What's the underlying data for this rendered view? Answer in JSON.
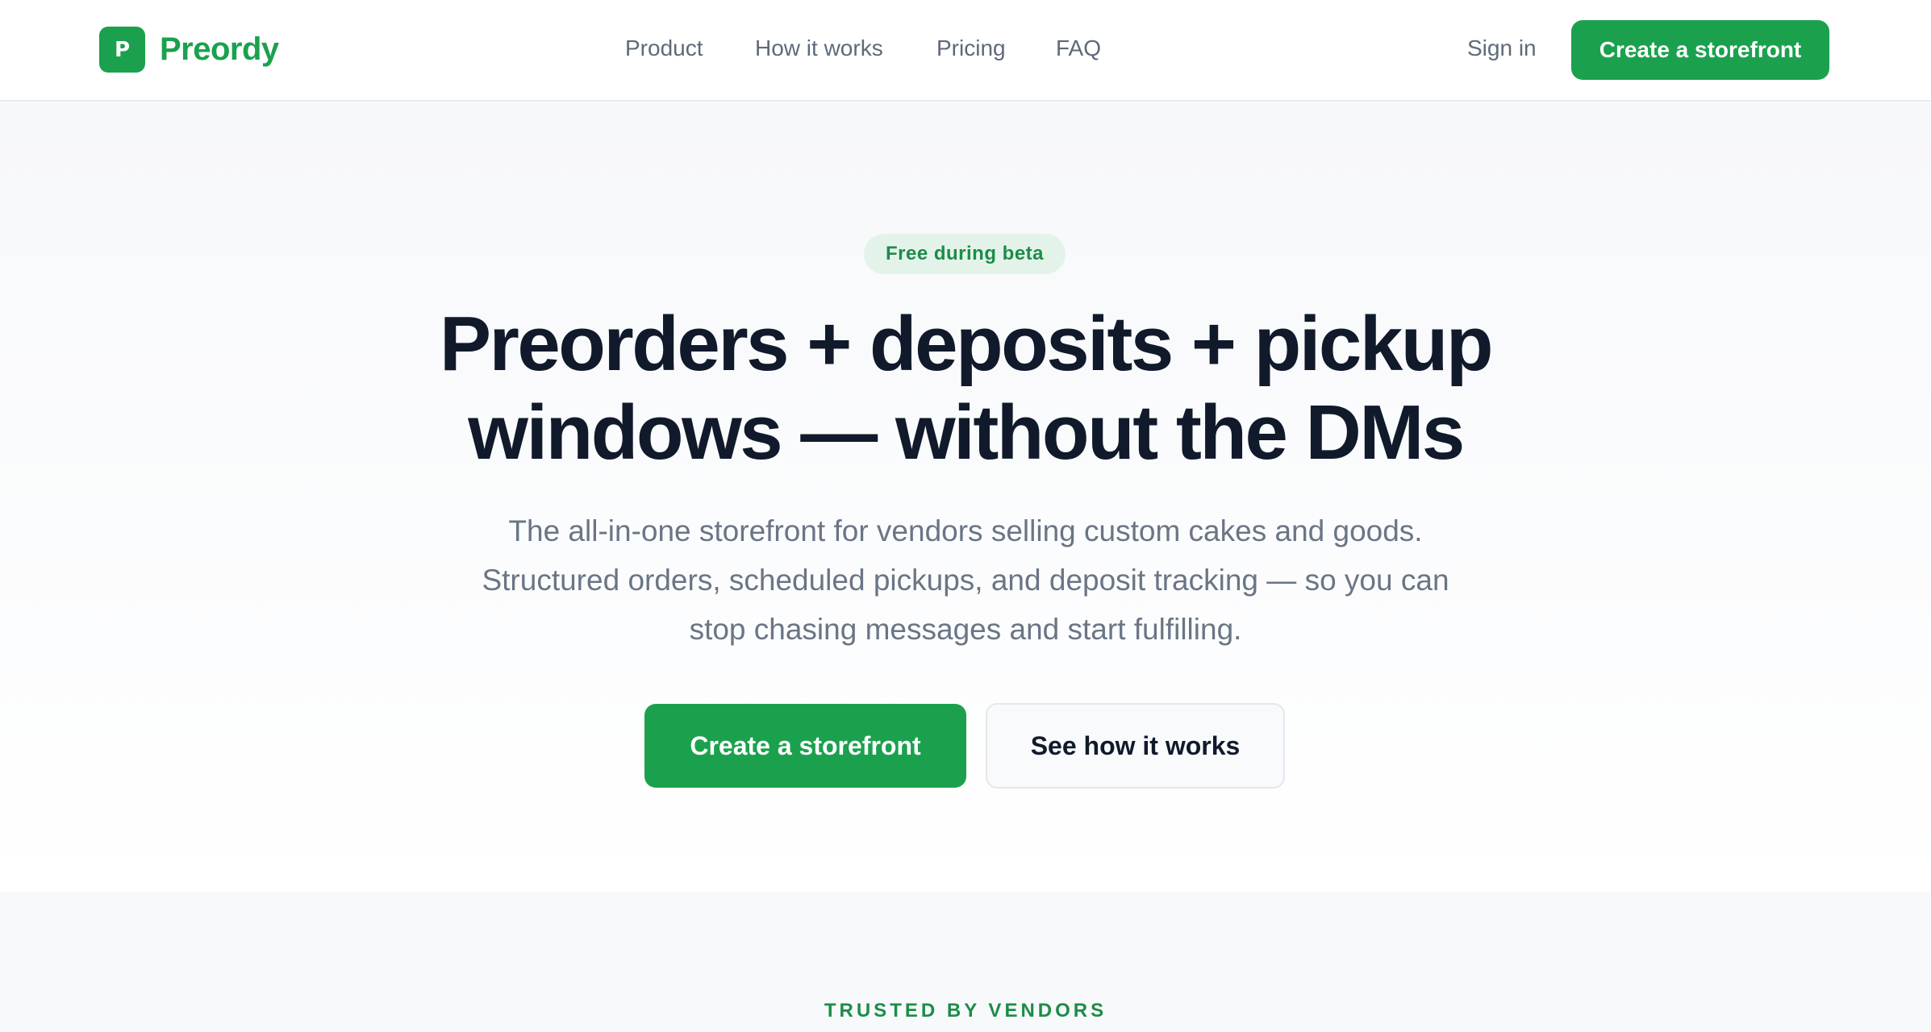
{
  "brand": {
    "logo_letter": "P",
    "name": "Preordy",
    "color": "#1ba14e"
  },
  "nav": {
    "items": [
      {
        "label": "Product"
      },
      {
        "label": "How it works"
      },
      {
        "label": "Pricing"
      },
      {
        "label": "FAQ"
      }
    ]
  },
  "header": {
    "signin_label": "Sign in",
    "cta_label": "Create a storefront"
  },
  "hero": {
    "badge": "Free during beta",
    "headline_line1": "Preorders + deposits + pickup",
    "headline_line2": "windows — without the DMs",
    "subhead_line1": "The all-in-one storefront for vendors selling custom cakes and goods.",
    "subhead_line2": "Structured orders, scheduled pickups, and deposit tracking — so you can",
    "subhead_line3": "stop chasing messages and start fulfilling.",
    "primary_cta": "Create a storefront",
    "secondary_cta": "See how it works"
  },
  "trusted": {
    "label": "TRUSTED BY VENDORS"
  },
  "colors": {
    "accent": "#1ba14e",
    "headline": "#111a2b",
    "muted_text": "#6a7585"
  }
}
